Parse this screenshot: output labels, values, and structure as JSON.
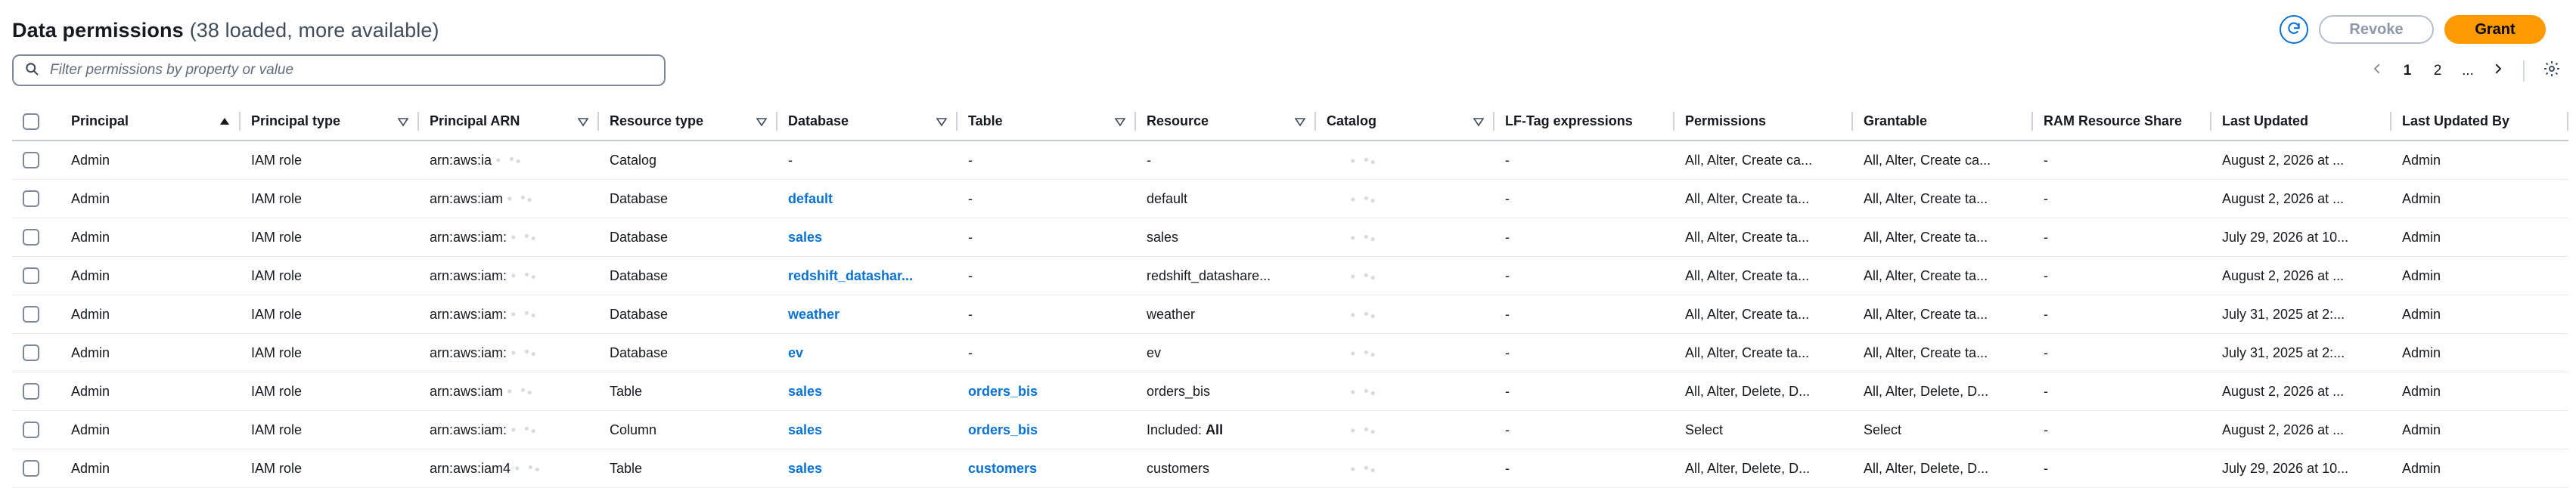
{
  "header": {
    "title": "Data permissions",
    "count_text": "(38 loaded, more available)",
    "revoke_label": "Revoke",
    "grant_label": "Grant"
  },
  "filter": {
    "placeholder": "Filter permissions by property or value"
  },
  "pagination": {
    "pages": [
      "1",
      "2",
      "..."
    ],
    "active": "1"
  },
  "colors": {
    "accent": "#0972d3",
    "grant": "#ff9900"
  },
  "icons": [
    "refresh-icon",
    "search-icon",
    "chevron-left-icon",
    "chevron-right-icon",
    "settings-icon",
    "sort-ascending-icon",
    "sort-descending-icon",
    "checkbox-icon"
  ],
  "table": {
    "columns": [
      {
        "label": "Principal",
        "sort": "asc"
      },
      {
        "label": "Principal type",
        "sort": "desc"
      },
      {
        "label": "Principal ARN",
        "sort": "desc"
      },
      {
        "label": "Resource type",
        "sort": "desc"
      },
      {
        "label": "Database",
        "sort": "desc"
      },
      {
        "label": "Table",
        "sort": "desc"
      },
      {
        "label": "Resource",
        "sort": "desc"
      },
      {
        "label": "Catalog",
        "sort": "desc"
      },
      {
        "label": "LF-Tag expressions",
        "sort": ""
      },
      {
        "label": "Permissions",
        "sort": ""
      },
      {
        "label": "Grantable",
        "sort": ""
      },
      {
        "label": "RAM Resource Share",
        "sort": ""
      },
      {
        "label": "Last Updated",
        "sort": ""
      },
      {
        "label": "Last Updated By",
        "sort": ""
      }
    ],
    "rows": [
      {
        "principal": "Admin",
        "principal_type": "IAM role",
        "principal_arn": "arn:aws:ia",
        "resource_type": "Catalog",
        "database": "-",
        "database_link": false,
        "table": "-",
        "table_link": false,
        "resource": "-",
        "resource_bold": "",
        "catalog": "",
        "lf": "-",
        "permissions": "All, Alter, Create ca...",
        "grantable": "All, Alter, Create ca...",
        "ram": "-",
        "last_updated": "August 2, 2026 at ...",
        "last_updated_by": "Admin"
      },
      {
        "principal": "Admin",
        "principal_type": "IAM role",
        "principal_arn": "arn:aws:iam",
        "resource_type": "Database",
        "database": "default",
        "database_link": true,
        "table": "-",
        "table_link": false,
        "resource": "default",
        "resource_bold": "",
        "catalog": "",
        "lf": "-",
        "permissions": "All, Alter, Create ta...",
        "grantable": "All, Alter, Create ta...",
        "ram": "-",
        "last_updated": "August 2, 2026 at ...",
        "last_updated_by": "Admin"
      },
      {
        "principal": "Admin",
        "principal_type": "IAM role",
        "principal_arn": "arn:aws:iam:",
        "resource_type": "Database",
        "database": "sales",
        "database_link": true,
        "table": "-",
        "table_link": false,
        "resource": "sales",
        "resource_bold": "",
        "catalog": "",
        "lf": "-",
        "permissions": "All, Alter, Create ta...",
        "grantable": "All, Alter, Create ta...",
        "ram": "-",
        "last_updated": "July 29, 2026 at 10...",
        "last_updated_by": "Admin"
      },
      {
        "principal": "Admin",
        "principal_type": "IAM role",
        "principal_arn": "arn:aws:iam:",
        "resource_type": "Database",
        "database": "redshift_datashar...",
        "database_link": true,
        "table": "-",
        "table_link": false,
        "resource": "redshift_datashare...",
        "resource_bold": "",
        "catalog": "",
        "lf": "-",
        "permissions": "All, Alter, Create ta...",
        "grantable": "All, Alter, Create ta...",
        "ram": "-",
        "last_updated": "August 2, 2026 at ...",
        "last_updated_by": "Admin"
      },
      {
        "principal": "Admin",
        "principal_type": "IAM role",
        "principal_arn": "arn:aws:iam:",
        "resource_type": "Database",
        "database": "weather",
        "database_link": true,
        "table": "-",
        "table_link": false,
        "resource": "weather",
        "resource_bold": "",
        "catalog": "",
        "lf": "-",
        "permissions": "All, Alter, Create ta...",
        "grantable": "All, Alter, Create ta...",
        "ram": "-",
        "last_updated": "July 31, 2025 at 2:...",
        "last_updated_by": "Admin"
      },
      {
        "principal": "Admin",
        "principal_type": "IAM role",
        "principal_arn": "arn:aws:iam:",
        "resource_type": "Database",
        "database": "ev",
        "database_link": true,
        "table": "-",
        "table_link": false,
        "resource": "ev",
        "resource_bold": "",
        "catalog": "",
        "lf": "-",
        "permissions": "All, Alter, Create ta...",
        "grantable": "All, Alter, Create ta...",
        "ram": "-",
        "last_updated": "July 31, 2025 at 2:...",
        "last_updated_by": "Admin"
      },
      {
        "principal": "Admin",
        "principal_type": "IAM role",
        "principal_arn": "arn:aws:iam",
        "resource_type": "Table",
        "database": "sales",
        "database_link": true,
        "table": "orders_bis",
        "table_link": true,
        "resource": "orders_bis",
        "resource_bold": "",
        "catalog": "",
        "lf": "-",
        "permissions": "All, Alter, Delete, D...",
        "grantable": "All, Alter, Delete, D...",
        "ram": "-",
        "last_updated": "August 2, 2026 at ...",
        "last_updated_by": "Admin"
      },
      {
        "principal": "Admin",
        "principal_type": "IAM role",
        "principal_arn": "arn:aws:iam:",
        "resource_type": "Column",
        "database": "sales",
        "database_link": true,
        "table": "orders_bis",
        "table_link": true,
        "resource": "Included: ",
        "resource_bold": "All",
        "catalog": "",
        "lf": "-",
        "permissions": "Select",
        "grantable": "Select",
        "ram": "-",
        "last_updated": "August 2, 2026 at ...",
        "last_updated_by": "Admin"
      },
      {
        "principal": "Admin",
        "principal_type": "IAM role",
        "principal_arn": "arn:aws:iam4",
        "resource_type": "Table",
        "database": "sales",
        "database_link": true,
        "table": "customers",
        "table_link": true,
        "resource": "customers",
        "resource_bold": "",
        "catalog": "",
        "lf": "-",
        "permissions": "All, Alter, Delete, D...",
        "grantable": "All, Alter, Delete, D...",
        "ram": "-",
        "last_updated": "July 29, 2026 at 10...",
        "last_updated_by": "Admin"
      }
    ]
  }
}
